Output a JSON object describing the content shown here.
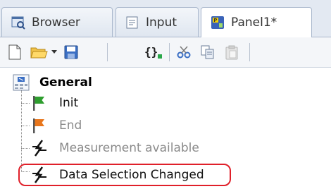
{
  "tabs": [
    {
      "label": "Browser",
      "icon": "browser-icon"
    },
    {
      "label": "Input",
      "icon": "input-icon"
    },
    {
      "label": "Panel1*",
      "icon": "panel-icon"
    }
  ],
  "toolbar": {
    "icons": [
      "new-file-icon",
      "open-folder-icon",
      "dropdown-arrow-icon",
      "save-icon",
      "braces-icon",
      "cut-icon",
      "copy-icon",
      "paste-icon"
    ]
  },
  "tree": {
    "root": {
      "label": "General",
      "icon": "group-icon"
    },
    "items": [
      {
        "label": "Init",
        "icon": "green-flag-icon"
      },
      {
        "label": "End",
        "icon": "orange-flag-icon"
      },
      {
        "label": "Measurement available",
        "icon": "lightning-icon"
      },
      {
        "label": "Data Selection Changed",
        "icon": "lightning-icon"
      }
    ]
  },
  "colors": {
    "highlight": "#e0202a",
    "flag_green": "#2e9e2e",
    "flag_orange": "#e8761c"
  }
}
